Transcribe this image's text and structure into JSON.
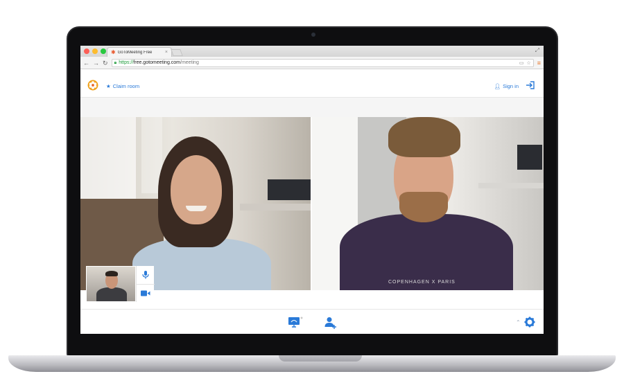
{
  "browser": {
    "tab_title": "GoToMeeting Free",
    "tab_close": "×",
    "url_scheme": "https://",
    "url_host": "free.gotomeeting.com",
    "url_path": "/meeting",
    "favicon": "asterisk-icon",
    "back": "←",
    "forward": "→",
    "reload": "↻",
    "menu": "≡"
  },
  "header": {
    "claim_label": "Claim room",
    "signin_label": "Sign in"
  },
  "video": {
    "participants": [
      "woman-video-tile",
      "man-video-tile"
    ],
    "shirt_text": "COPENHAGEN X PARIS"
  },
  "colors": {
    "accent": "#2a7ad8",
    "logo": "#f0a21c"
  }
}
